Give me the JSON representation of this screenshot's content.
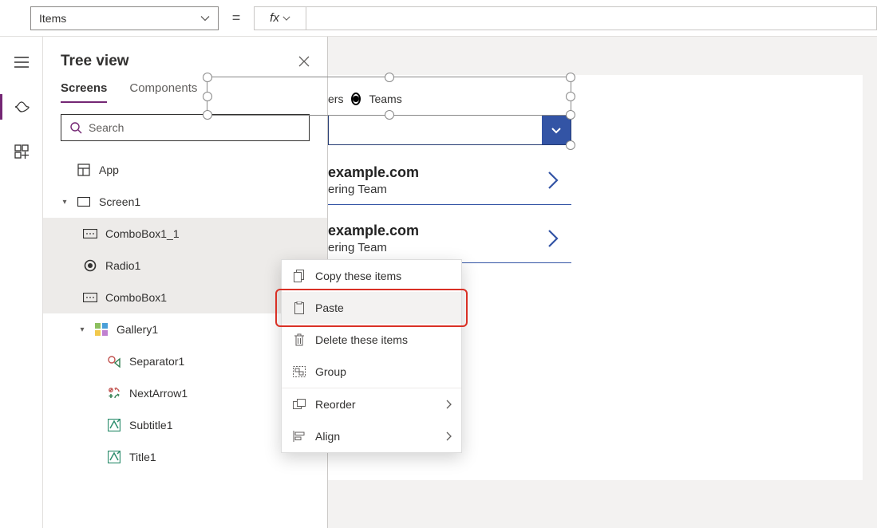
{
  "formula": {
    "property": "Items",
    "fx_label": "fx"
  },
  "tree": {
    "title": "Tree view",
    "tabs": {
      "screens": "Screens",
      "components": "Components"
    },
    "search_placeholder": "Search",
    "app": "App",
    "screen1": "Screen1",
    "combo1_1": "ComboBox1_1",
    "radio1": "Radio1",
    "combo1": "ComboBox1",
    "gallery1": "Gallery1",
    "separator1": "Separator1",
    "nextarrow1": "NextArrow1",
    "subtitle1": "Subtitle1",
    "title1": "Title1"
  },
  "canvas": {
    "radio_opt1_tail": "ers",
    "radio_opt2": "Teams",
    "gallery": [
      {
        "title_tail": "example.com",
        "subtitle_tail": "ering Team"
      },
      {
        "title_tail": "example.com",
        "subtitle_tail": "ering Team"
      }
    ]
  },
  "context_menu": {
    "copy": "Copy these items",
    "paste": "Paste",
    "delete": "Delete these items",
    "group": "Group",
    "reorder": "Reorder",
    "align": "Align"
  }
}
